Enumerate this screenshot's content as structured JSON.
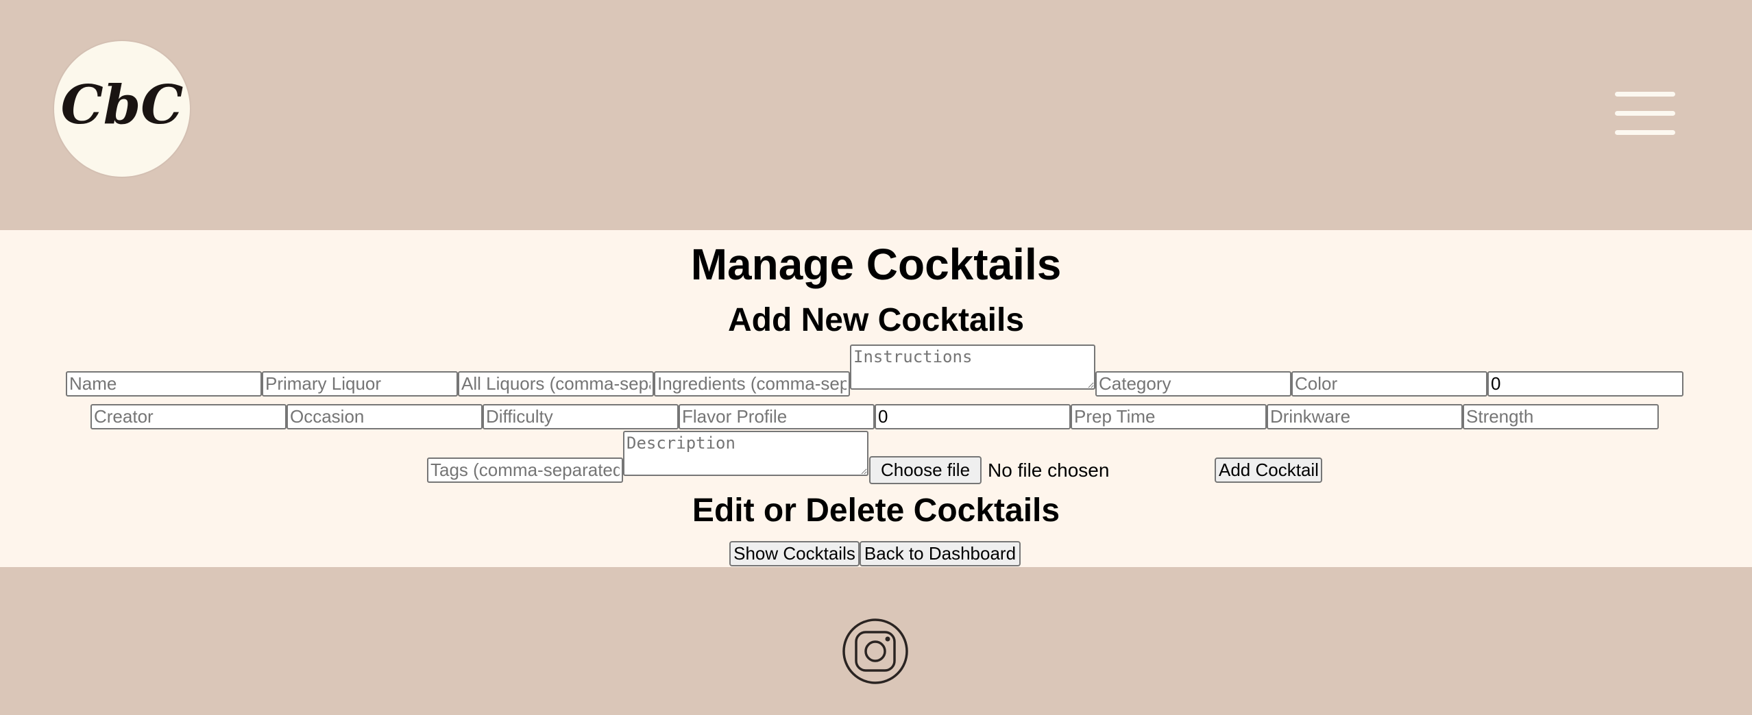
{
  "header": {
    "logo_text": "CbC",
    "menu_icon": "hamburger-menu-icon"
  },
  "page": {
    "title": "Manage Cocktails",
    "add_heading": "Add New Cocktails",
    "edit_heading": "Edit or Delete Cocktails"
  },
  "form": {
    "name_placeholder": "Name",
    "primary_liquor_placeholder": "Primary Liquor",
    "all_liquors_placeholder": "All Liquors (comma-separated)",
    "ingredients_placeholder": "Ingredients (comma-separated)",
    "instructions_placeholder": "Instructions",
    "category_placeholder": "Category",
    "color_placeholder": "Color",
    "number_1_value": "0",
    "creator_placeholder": "Creator",
    "occasion_placeholder": "Occasion",
    "difficulty_placeholder": "Difficulty",
    "flavor_profile_placeholder": "Flavor Profile",
    "number_2_value": "0",
    "prep_time_placeholder": "Prep Time",
    "drinkware_placeholder": "Drinkware",
    "strength_placeholder": "Strength",
    "tags_placeholder": "Tags (comma-separated)",
    "description_placeholder": "Description",
    "choose_file_label": "Choose file",
    "no_file_text": "No file chosen",
    "add_button_label": "Add Cocktail"
  },
  "actions": {
    "show_cocktails_label": "Show Cocktails",
    "back_to_dashboard_label": "Back to Dashboard"
  },
  "footer": {
    "social_icon": "instagram-icon"
  },
  "colors": {
    "header_bg": "#dac6b8",
    "main_bg": "#fef5ec",
    "footer_bg": "#dac6b8",
    "logo_bg": "#fcf8ec"
  }
}
